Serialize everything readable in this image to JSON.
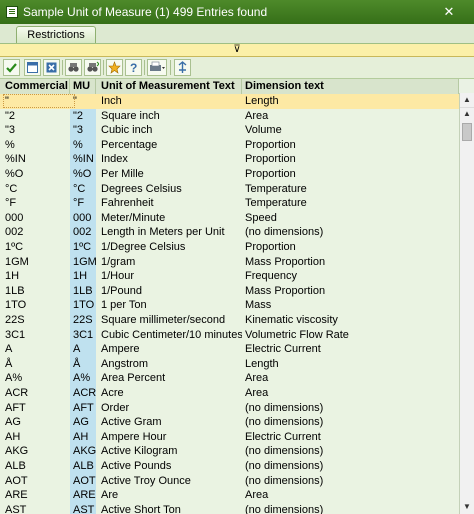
{
  "window": {
    "title": "Sample Unit of Measure (1)  499 Entries found",
    "close_label": "✕"
  },
  "tabs": [
    {
      "label": "Restrictions"
    }
  ],
  "toolbar": {
    "buttons": [
      "checkmark-icon",
      "window-list-icon",
      "delete-icon",
      "find-icon",
      "find-next-icon",
      "favorites-icon",
      "help-icon",
      "print-icon",
      "sum-icon"
    ]
  },
  "table": {
    "columns": [
      "Commercial",
      "MU",
      "Unit of Measurement Text",
      "Dimension text"
    ],
    "rows": [
      [
        "\"",
        "\"",
        "Inch",
        "Length"
      ],
      [
        "\"2",
        "\"2",
        "Square inch",
        "Area"
      ],
      [
        "\"3",
        "\"3",
        "Cubic inch",
        "Volume"
      ],
      [
        "%",
        "%",
        "Percentage",
        "Proportion"
      ],
      [
        "%IN",
        "%IN",
        "Index",
        "Proportion"
      ],
      [
        "%O",
        "%O",
        "Per Mille",
        "Proportion"
      ],
      [
        "°C",
        "°C",
        "Degrees Celsius",
        "Temperature"
      ],
      [
        "°F",
        "°F",
        "Fahrenheit",
        "Temperature"
      ],
      [
        "000",
        "000",
        "Meter/Minute",
        "Speed"
      ],
      [
        "002",
        "002",
        "Length in Meters per Unit",
        "(no dimensions)"
      ],
      [
        "1ºC",
        "1ºC",
        "1/Degree Celsius",
        "Proportion"
      ],
      [
        "1GM",
        "1GM",
        "1/gram",
        "Mass Proportion"
      ],
      [
        "1H",
        "1H",
        "1/Hour",
        "Frequency"
      ],
      [
        "1LB",
        "1LB",
        "1/Pound",
        "Mass Proportion"
      ],
      [
        "1TO",
        "1TO",
        "1 per Ton",
        "Mass"
      ],
      [
        "22S",
        "22S",
        "Square millimeter/second",
        "Kinematic viscosity"
      ],
      [
        "3C1",
        "3C1",
        "Cubic Centimeter/10 minutes",
        "Volumetric Flow Rate"
      ],
      [
        "A",
        "A",
        "Ampere",
        "Electric Current"
      ],
      [
        "Å",
        "Å",
        "Angstrom",
        "Length"
      ],
      [
        "A%",
        "A%",
        "Area Percent",
        "Area"
      ],
      [
        "ACR",
        "ACR",
        "Acre",
        "Area"
      ],
      [
        "AFT",
        "AFT",
        "Order",
        "(no dimensions)"
      ],
      [
        "AG",
        "AG",
        "Active Gram",
        "(no dimensions)"
      ],
      [
        "AH",
        "AH",
        "Ampere Hour",
        "Electric Current"
      ],
      [
        "AKG",
        "AKG",
        "Active Kilogram",
        "(no dimensions)"
      ],
      [
        "ALB",
        "ALB",
        "Active Pounds",
        "(no dimensions)"
      ],
      [
        "AOT",
        "AOT",
        "Active Troy Ounce",
        "(no dimensions)"
      ],
      [
        "ARE",
        "ARE",
        "Are",
        "Area"
      ],
      [
        "AST",
        "AST",
        "Active Short Ton",
        "(no dimensions)"
      ]
    ],
    "selected_row": 0
  },
  "colors": {
    "title_bar": "#356f18",
    "selection": "#fde9a4",
    "mu_column": "#bfe1ef",
    "restriction_splitter": "#fbf0a8"
  }
}
